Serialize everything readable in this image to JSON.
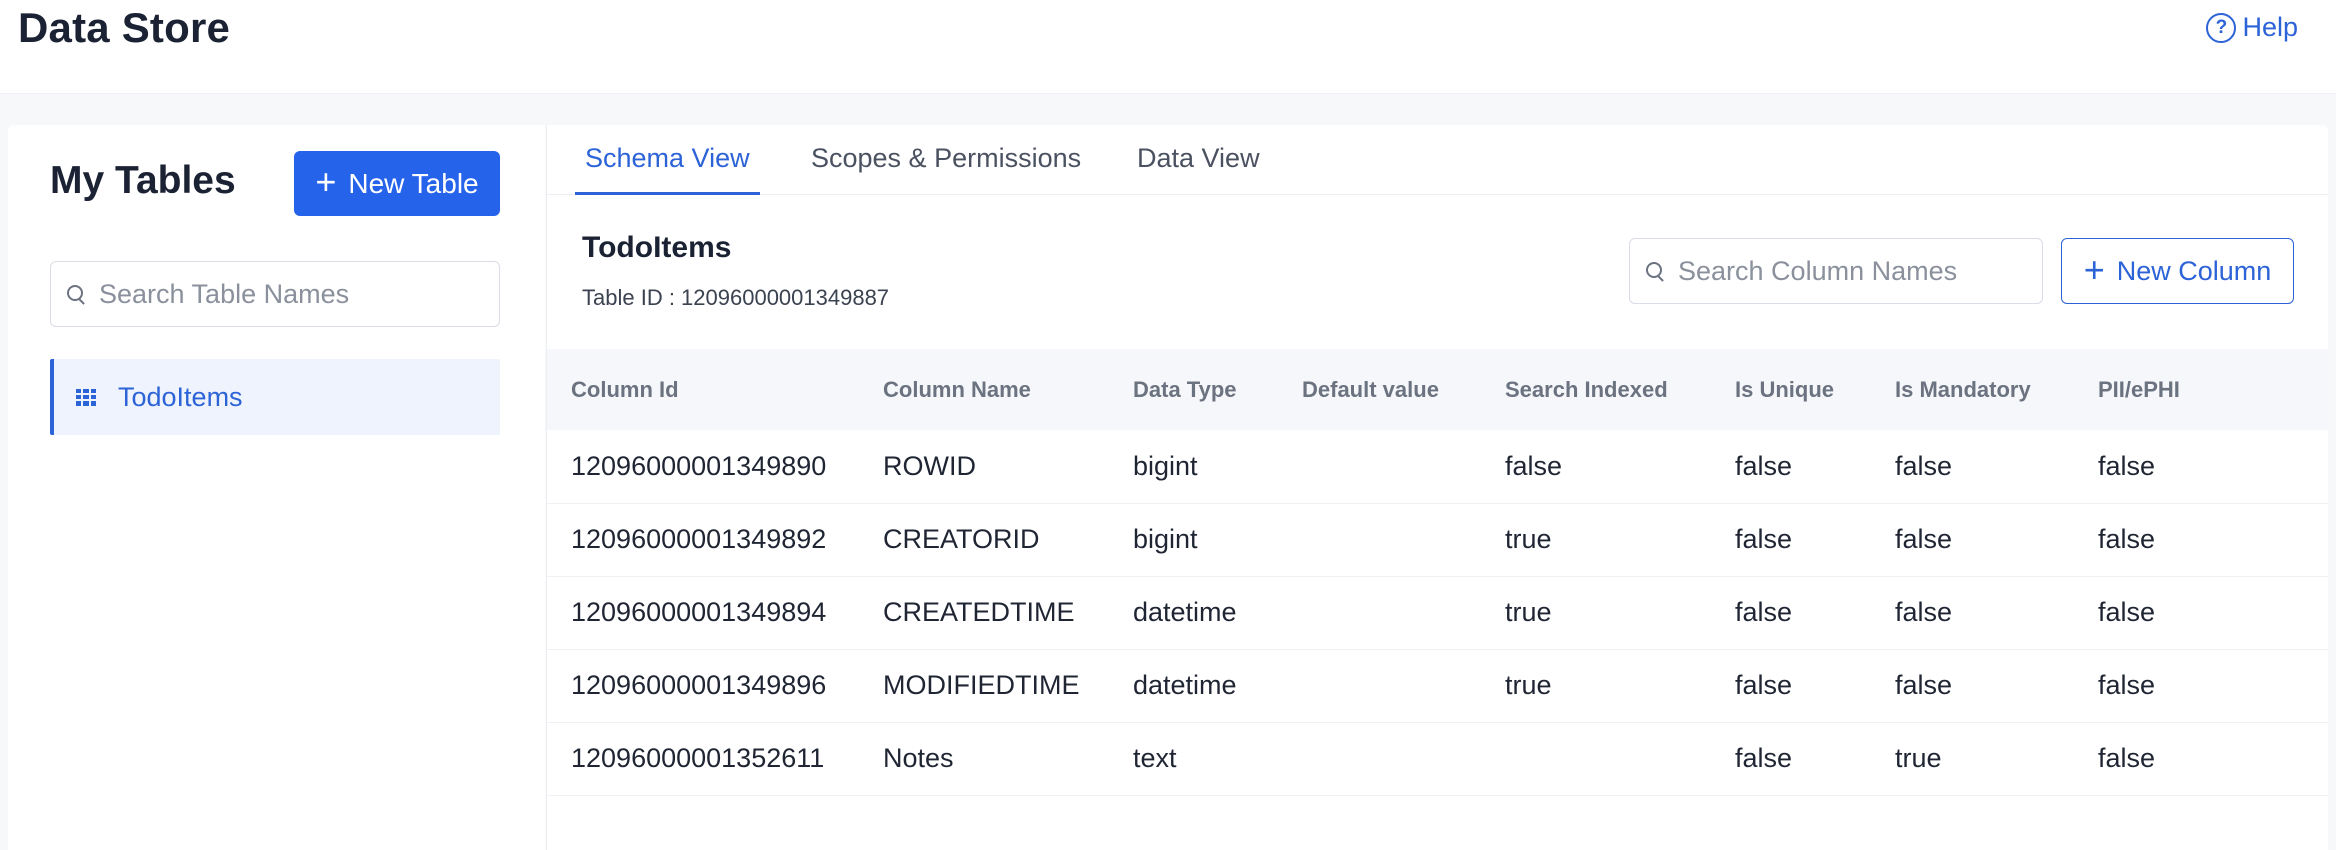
{
  "header": {
    "title": "Data Store",
    "help_label": "Help"
  },
  "sidebar": {
    "title": "My Tables",
    "new_table_label": "New Table",
    "search_placeholder": "Search Table Names",
    "tables": [
      {
        "label": "TodoItems",
        "selected": true
      }
    ]
  },
  "main": {
    "tabs": [
      {
        "label": "Schema View",
        "active": true
      },
      {
        "label": "Scopes & Permissions",
        "active": false
      },
      {
        "label": "Data View",
        "active": false
      }
    ],
    "table_name": "TodoItems",
    "table_id_text": "Table ID : 12096000001349887",
    "search_columns_placeholder": "Search Column Names",
    "new_column_label": "New Column",
    "columns": [
      "Column Id",
      "Column Name",
      "Data Type",
      "Default value",
      "Search Indexed",
      "Is Unique",
      "Is Mandatory",
      "PII/ePHI"
    ],
    "rows": [
      [
        "12096000001349890",
        "ROWID",
        "bigint",
        "",
        "false",
        "false",
        "false",
        "false"
      ],
      [
        "12096000001349892",
        "CREATORID",
        "bigint",
        "",
        "true",
        "false",
        "false",
        "false"
      ],
      [
        "12096000001349894",
        "CREATEDTIME",
        "datetime",
        "",
        "true",
        "false",
        "false",
        "false"
      ],
      [
        "12096000001349896",
        "MODIFIEDTIME",
        "datetime",
        "",
        "true",
        "false",
        "false",
        "false"
      ],
      [
        "12096000001352611",
        "Notes",
        "text",
        "",
        "",
        "false",
        "true",
        "false"
      ]
    ]
  },
  "colors": {
    "accent": "#2563eb",
    "accent_text": "#2c63d6",
    "selected_bg": "#eef3fd"
  }
}
